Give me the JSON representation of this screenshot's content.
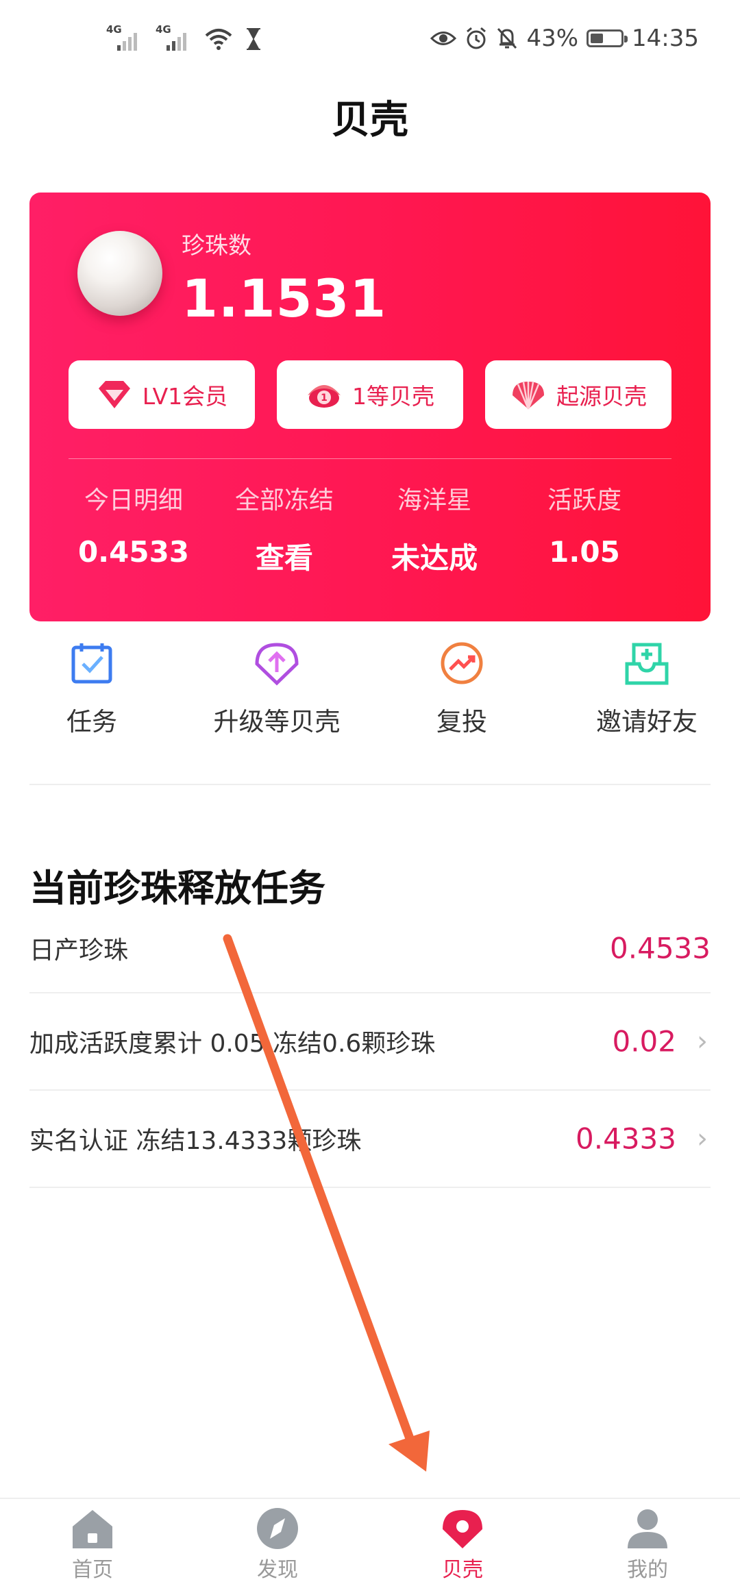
{
  "status_bar": {
    "net1": "4G",
    "net2": "4G",
    "battery_percent": "43%",
    "battery_level": 0.43,
    "time": "14:35"
  },
  "page": {
    "title": "贝壳"
  },
  "pearl_card": {
    "label": "珍珠数",
    "value": "1.1531",
    "badges": [
      {
        "label": "LV1会员",
        "icon": "diamond-icon"
      },
      {
        "label": "1等贝壳",
        "icon": "oyster-icon"
      },
      {
        "label": "起源贝壳",
        "icon": "scallop-shell-icon"
      }
    ],
    "stats": [
      {
        "label": "今日明细",
        "value": "0.4533"
      },
      {
        "label": "全部冻结",
        "value": "查看"
      },
      {
        "label": "海洋星",
        "value": "未达成"
      },
      {
        "label": "活跃度",
        "value": "1.05"
      }
    ]
  },
  "actions": [
    {
      "label": "任务",
      "icon": "calendar-check-icon",
      "color": "#3d7cf0"
    },
    {
      "label": "升级等贝壳",
      "icon": "upgrade-shell-icon",
      "color": "#b04ee0"
    },
    {
      "label": "复投",
      "icon": "reinvest-chart-icon",
      "color": "#f08040"
    },
    {
      "label": "邀请好友",
      "icon": "invite-inbox-icon",
      "color": "#2fd4a8"
    }
  ],
  "tasks": {
    "title": "当前珍珠释放任务",
    "rows": [
      {
        "text": "日产珍珠",
        "value": "0.4533",
        "has_chevron": false
      },
      {
        "text": "加成活跃度累计 0.05  冻结0.6颗珍珠",
        "value": "0.02",
        "has_chevron": true
      },
      {
        "text": "实名认证  冻结13.4333颗珍珠",
        "value": "0.4333",
        "has_chevron": true
      }
    ]
  },
  "bottom_nav": [
    {
      "label": "首页",
      "icon": "home-icon",
      "active": false
    },
    {
      "label": "发现",
      "icon": "compass-icon",
      "active": false
    },
    {
      "label": "贝壳",
      "icon": "shell-icon",
      "active": true
    },
    {
      "label": "我的",
      "icon": "profile-icon",
      "active": false
    }
  ],
  "colors": {
    "accent": "#e8204f",
    "card_gradient_start": "#ff1f66",
    "card_gradient_end": "#ff1338",
    "task_value": "#d81b60",
    "annotation_arrow": "#f2673a"
  }
}
